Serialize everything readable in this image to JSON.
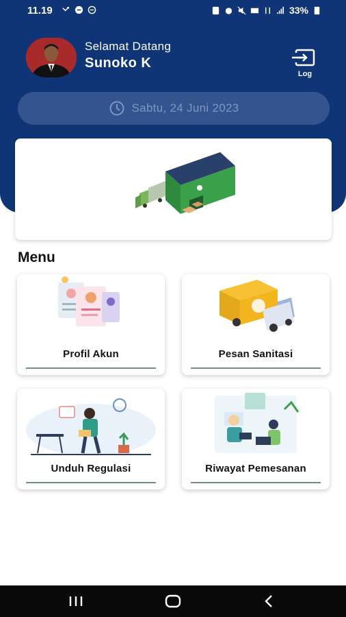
{
  "status_bar": {
    "time": "11.19",
    "battery": "33%"
  },
  "header": {
    "welcome": "Selamat Datang",
    "username": "Sunoko K",
    "logout_label": "Log"
  },
  "date": {
    "text": "Sabtu, 24 Juni 2023"
  },
  "menu": {
    "title": "Menu",
    "items": [
      {
        "label": "Profil Akun"
      },
      {
        "label": "Pesan Sanitasi"
      },
      {
        "label": "Unduh Regulasi"
      },
      {
        "label": "Riwayat Pemesanan"
      }
    ]
  },
  "colors": {
    "header": "#0f3577",
    "accent_underline": "#6c8f90"
  }
}
